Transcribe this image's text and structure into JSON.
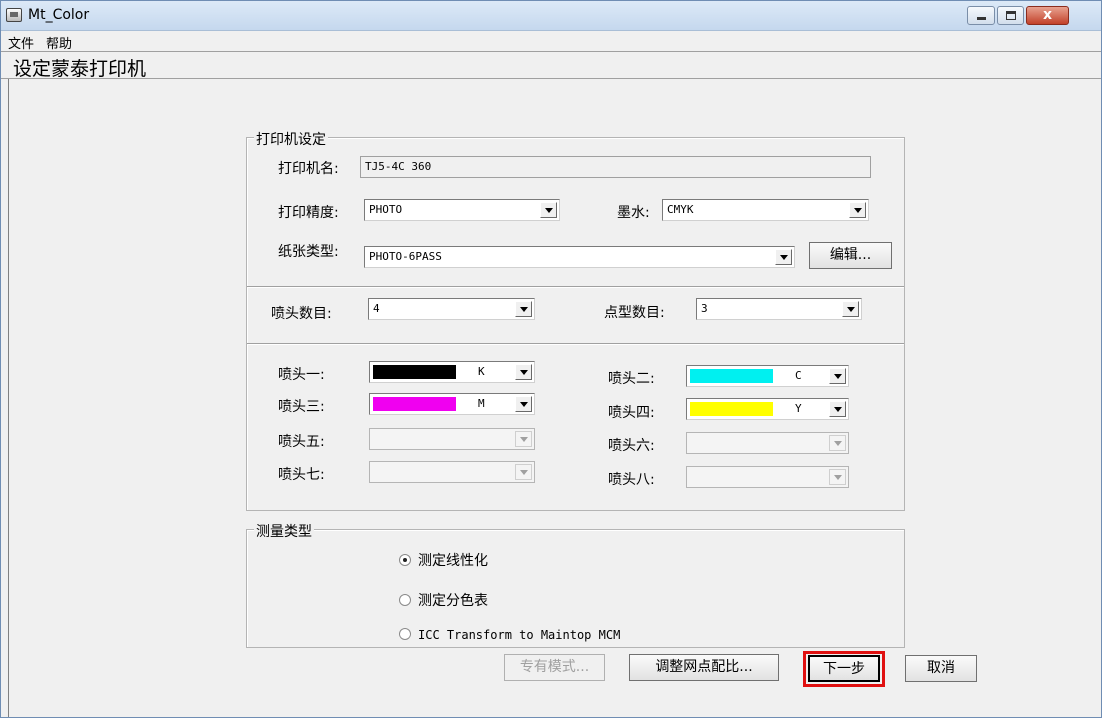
{
  "window": {
    "title": "Mt_Color",
    "close_glyph": "x"
  },
  "menu": {
    "items": [
      "文件",
      "帮助"
    ]
  },
  "header": {
    "title": "设定蒙泰打印机"
  },
  "printer_settings": {
    "group_title": "打印机设定",
    "printer_name_label": "打印机名:",
    "printer_name_value": "TJ5-4C 360",
    "precision_label": "打印精度:",
    "precision_value": "PHOTO",
    "ink_label": "墨水:",
    "ink_value": "CMYK",
    "paper_label": "纸张类型:",
    "paper_value": "PHOTO-6PASS",
    "edit_button": "编辑..."
  },
  "heads": {
    "head_count_label": "喷头数目:",
    "head_count_value": "4",
    "dot_count_label": "点型数目:",
    "dot_count_value": "3",
    "items": [
      {
        "label": "喷头一:",
        "letter": "K",
        "color": "#000000",
        "enabled": true
      },
      {
        "label": "喷头二:",
        "letter": "C",
        "color": "#00f0f0",
        "enabled": true
      },
      {
        "label": "喷头三:",
        "letter": "M",
        "color": "#f000f0",
        "enabled": true
      },
      {
        "label": "喷头四:",
        "letter": "Y",
        "color": "#ffff00",
        "enabled": true
      },
      {
        "label": "喷头五:",
        "letter": "",
        "color": "",
        "enabled": false
      },
      {
        "label": "喷头六:",
        "letter": "",
        "color": "",
        "enabled": false
      },
      {
        "label": "喷头七:",
        "letter": "",
        "color": "",
        "enabled": false
      },
      {
        "label": "喷头八:",
        "letter": "",
        "color": "",
        "enabled": false
      }
    ]
  },
  "measure": {
    "group_title": "测量类型",
    "options": [
      {
        "label": "测定线性化",
        "selected": true
      },
      {
        "label": "测定分色表",
        "selected": false
      },
      {
        "label": "ICC Transform to Maintop MCM",
        "selected": false
      }
    ]
  },
  "buttons": {
    "exclusive_mode": "专有模式...",
    "adjust_dot_ratio": "调整网点配比...",
    "next": "下一步",
    "cancel": "取消"
  },
  "colors": {
    "highlight": "#e01010",
    "titlebar": "#c5d8ee"
  }
}
